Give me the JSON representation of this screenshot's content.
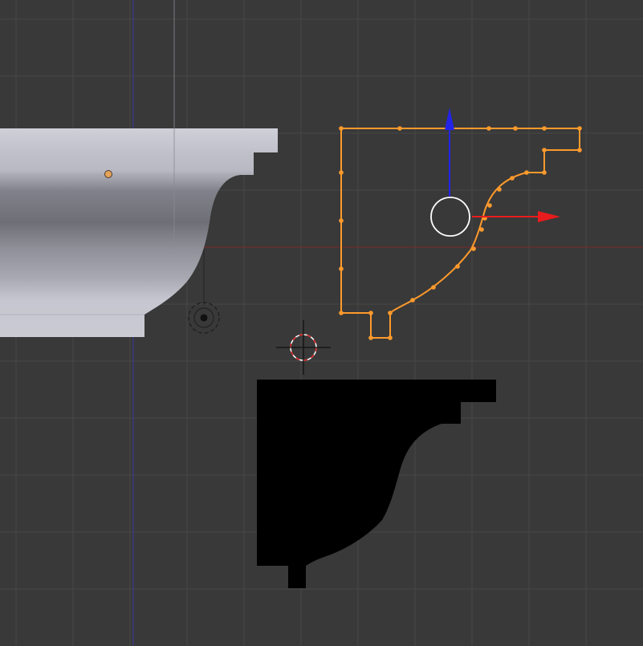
{
  "viewport": {
    "background_color": "#393939",
    "grid_color": "#474747",
    "z_axis_color": "#3a3a8a",
    "x_axis_color": "#8a3030"
  },
  "objects": {
    "crown_molding_mesh": {
      "shading_light": "#c9cad3",
      "shading_dark": "#6e6e74"
    },
    "profile_curve": {
      "selected_color": "#ff9a2c",
      "vertex_color": "#ff9a2c"
    },
    "filled_profile": {
      "fill_color": "#000000"
    }
  },
  "gizmo": {
    "z_arrow_color": "#2323e8",
    "x_arrow_color": "#e81c1c",
    "pivot_ring_color": "#ffffff"
  },
  "icons": {
    "object_origin": "origin-dot-icon",
    "cursor": "3d-cursor-icon",
    "empty": "empty-target-icon"
  }
}
